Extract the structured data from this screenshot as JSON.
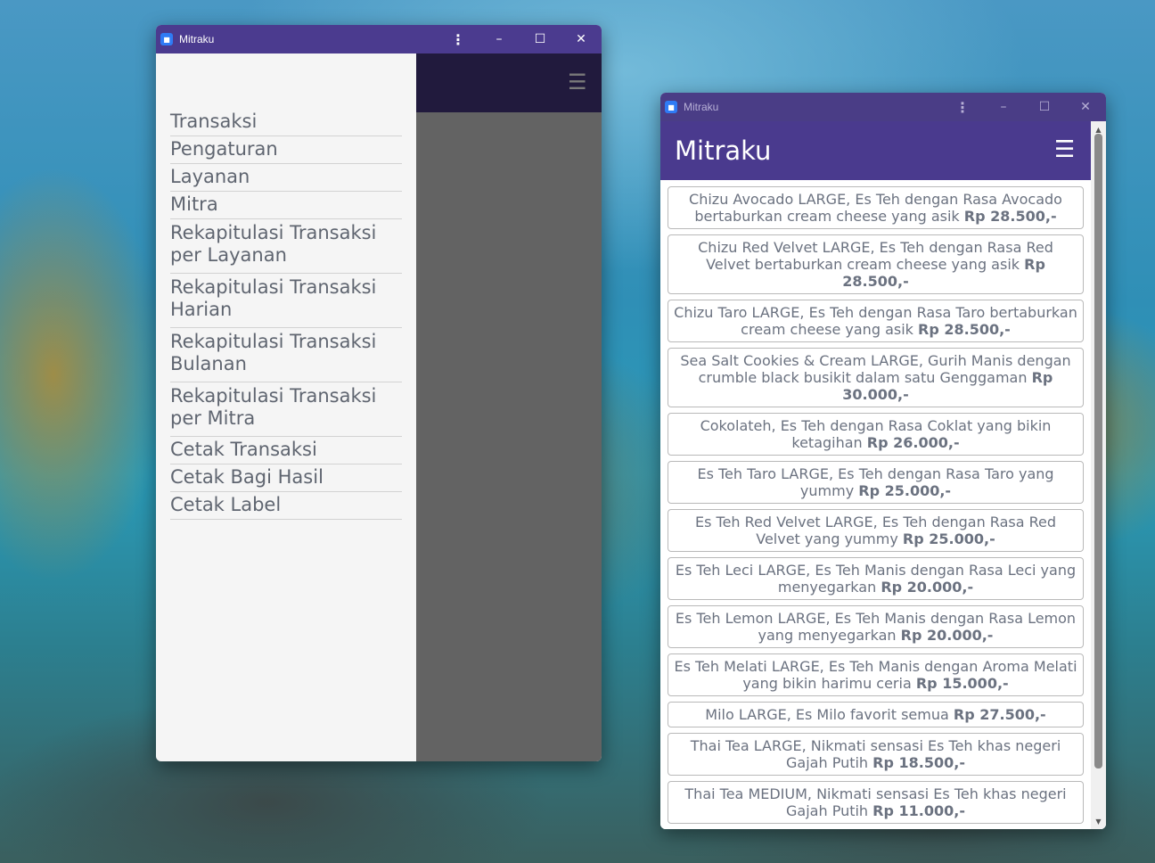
{
  "window_left": {
    "title": "Mitraku",
    "menu": [
      "Transaksi",
      "Pengaturan",
      "Layanan",
      "Mitra",
      "Rekapitulasi Transaksi per Layanan",
      "Rekapitulasi Transaksi Harian",
      "Rekapitulasi Transaksi Bulanan",
      "Rekapitulasi Transaksi per Mitra",
      "Cetak Transaksi",
      "Cetak Bagi Hasil",
      "Cetak Label"
    ]
  },
  "window_right": {
    "title": "Mitraku",
    "app_title": "Mitraku",
    "products": [
      {
        "desc": "Chizu Avocado LARGE, Es Teh dengan Rasa Avocado bertaburkan cream cheese yang asik",
        "price": "Rp 28.500,-"
      },
      {
        "desc": "Chizu Red Velvet LARGE, Es Teh dengan Rasa Red Velvet bertaburkan cream cheese yang asik",
        "price": "Rp 28.500,-"
      },
      {
        "desc": "Chizu Taro LARGE, Es Teh dengan Rasa Taro bertaburkan cream cheese yang asik",
        "price": "Rp 28.500,-"
      },
      {
        "desc": "Sea Salt Cookies & Cream LARGE, Gurih Manis dengan crumble black busikit dalam satu Genggaman",
        "price": "Rp 30.000,-"
      },
      {
        "desc": "Cokolateh, Es Teh dengan Rasa Coklat yang bikin ketagihan",
        "price": "Rp 26.000,-"
      },
      {
        "desc": "Es Teh Taro LARGE, Es Teh dengan Rasa Taro yang yummy",
        "price": "Rp 25.000,-"
      },
      {
        "desc": "Es Teh Red Velvet LARGE, Es Teh dengan Rasa Red Velvet yang yummy",
        "price": "Rp 25.000,-"
      },
      {
        "desc": "Es Teh Leci LARGE, Es Teh Manis dengan Rasa Leci yang menyegarkan",
        "price": "Rp 20.000,-"
      },
      {
        "desc": "Es Teh Lemon LARGE, Es Teh Manis dengan Rasa Lemon yang menyegarkan",
        "price": "Rp 20.000,-"
      },
      {
        "desc": "Es Teh Melati LARGE, Es Teh Manis dengan Aroma Melati yang bikin harimu ceria",
        "price": "Rp 15.000,-"
      },
      {
        "desc": "Milo LARGE, Es Milo favorit semua",
        "price": "Rp 27.500,-"
      },
      {
        "desc": "Thai Tea LARGE, Nikmati sensasi Es Teh khas negeri Gajah Putih",
        "price": "Rp 18.500,-"
      },
      {
        "desc": "Thai Tea MEDIUM, Nikmati sensasi Es Teh khas negeri Gajah Putih",
        "price": "Rp 11.000,-"
      }
    ]
  },
  "icons": {
    "kebab": "⋮",
    "minimize": "–",
    "maximize": "☐",
    "close": "✕",
    "hamburger": "☰",
    "scroll_up": "▲",
    "scroll_down": "▼"
  },
  "colors": {
    "titlebar": "#4b3b8f",
    "appbar": "#4a3a8e",
    "overlay": "#636363",
    "drawer": "#f5f5f5",
    "text_gray": "#6b7280"
  }
}
